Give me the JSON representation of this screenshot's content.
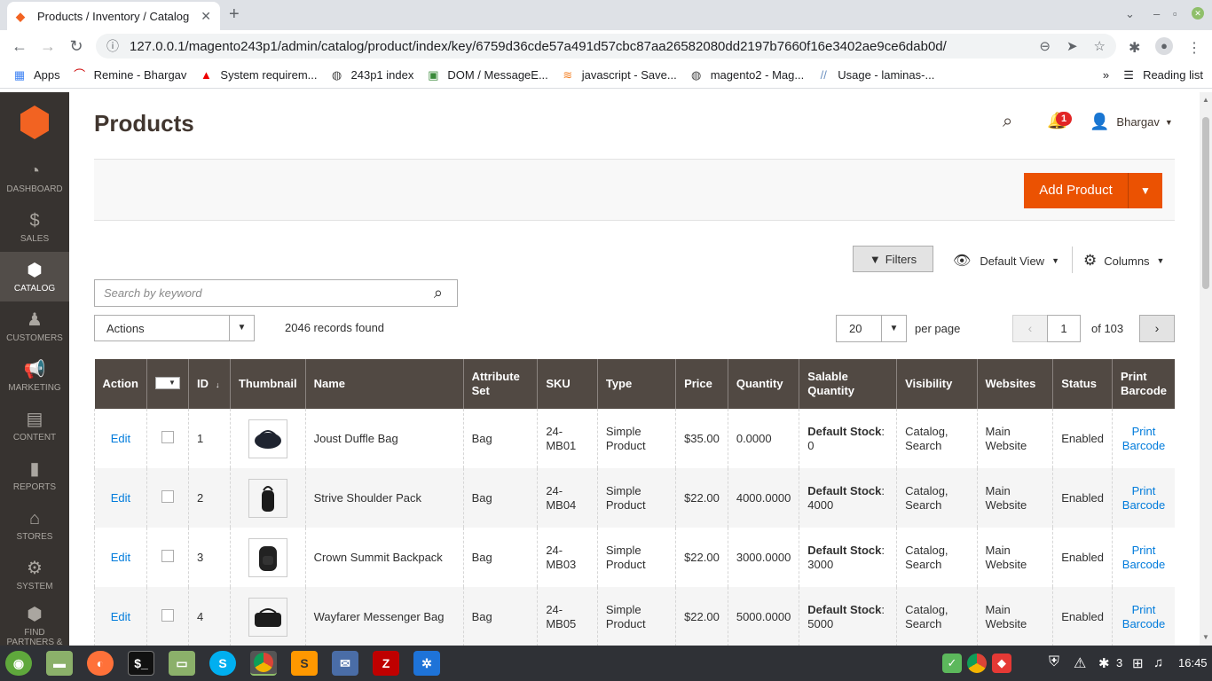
{
  "browser": {
    "tab_title": "Products / Inventory / Catalog",
    "url": "127.0.0.1/magento243p1/admin/catalog/product/index/key/6759d36cde57a491d57cbc87aa26582080dd2197b7660f16e3402ae9ce6dab0d/",
    "bookmarks": [
      {
        "label": "Apps",
        "icon": "apps-icon"
      },
      {
        "label": "Remine - Bhargav",
        "icon": "remine-icon"
      },
      {
        "label": "System requirem...",
        "icon": "adobe-icon"
      },
      {
        "label": "243p1 index",
        "icon": "globe-icon"
      },
      {
        "label": "DOM / MessageE...",
        "icon": "page-icon"
      },
      {
        "label": "javascript - Save...",
        "icon": "stackoverflow-icon"
      },
      {
        "label": "magento2 - Mag...",
        "icon": "globe-icon"
      },
      {
        "label": "Usage - laminas-...",
        "icon": "laminas-icon"
      }
    ],
    "reading_list": "Reading list"
  },
  "sidebar": {
    "items": [
      {
        "label": "DASHBOARD",
        "icon": "dashboard-icon",
        "glyph": "◔"
      },
      {
        "label": "SALES",
        "icon": "dollar-icon",
        "glyph": "$"
      },
      {
        "label": "CATALOG",
        "icon": "box-icon",
        "glyph": "⬢"
      },
      {
        "label": "CUSTOMERS",
        "icon": "person-icon",
        "glyph": "♟"
      },
      {
        "label": "MARKETING",
        "icon": "megaphone-icon",
        "glyph": "📢"
      },
      {
        "label": "CONTENT",
        "icon": "layout-icon",
        "glyph": "▤"
      },
      {
        "label": "REPORTS",
        "icon": "bar-chart-icon",
        "glyph": "▮"
      },
      {
        "label": "STORES",
        "icon": "store-icon",
        "glyph": "⌂"
      },
      {
        "label": "SYSTEM",
        "icon": "gear-icon",
        "glyph": "⚙"
      },
      {
        "label": "FIND PARTNERS & EXTENSIONS",
        "icon": "partners-icon",
        "glyph": "⬢"
      }
    ]
  },
  "header": {
    "title": "Products",
    "notifications": "1",
    "user": "Bhargav"
  },
  "toolbar": {
    "add_product": "Add Product",
    "filters": "Filters",
    "default_view": "Default View",
    "columns": "Columns",
    "search_placeholder": "Search by keyword",
    "actions": "Actions",
    "records": "2046 records found",
    "per_page_value": "20",
    "per_page_label": "per page",
    "page": "1",
    "of_pages": "of 103"
  },
  "table": {
    "headers": [
      "Action",
      "",
      "ID",
      "Thumbnail",
      "Name",
      "Attribute Set",
      "SKU",
      "Type",
      "Price",
      "Quantity",
      "Salable Quantity",
      "Visibility",
      "Websites",
      "Status",
      "Print Barcode"
    ],
    "rows": [
      {
        "action": "Edit",
        "id": "1",
        "name": "Joust Duffle Bag",
        "attr": "Bag",
        "sku": "24-MB01",
        "type": "Simple Product",
        "price": "$35.00",
        "qty": "0.0000",
        "salable_label": "Default Stock",
        "salable_value": ": 0",
        "visibility": "Catalog, Search",
        "websites": "Main Website",
        "status": "Enabled",
        "barcode": "Print Barcode"
      },
      {
        "action": "Edit",
        "id": "2",
        "name": "Strive Shoulder Pack",
        "attr": "Bag",
        "sku": "24-MB04",
        "type": "Simple Product",
        "price": "$22.00",
        "qty": "4000.0000",
        "salable_label": "Default Stock",
        "salable_value": ": 4000",
        "visibility": "Catalog, Search",
        "websites": "Main Website",
        "status": "Enabled",
        "barcode": "Print Barcode"
      },
      {
        "action": "Edit",
        "id": "3",
        "name": "Crown Summit Backpack",
        "attr": "Bag",
        "sku": "24-MB03",
        "type": "Simple Product",
        "price": "$22.00",
        "qty": "3000.0000",
        "salable_label": "Default Stock",
        "salable_value": ": 3000",
        "visibility": "Catalog, Search",
        "websites": "Main Website",
        "status": "Enabled",
        "barcode": "Print Barcode"
      },
      {
        "action": "Edit",
        "id": "4",
        "name": "Wayfarer Messenger Bag",
        "attr": "Bag",
        "sku": "24-MB05",
        "type": "Simple Product",
        "price": "$22.00",
        "qty": "5000.0000",
        "salable_label": "Default Stock",
        "salable_value": ": 5000",
        "visibility": "Catalog, Search",
        "websites": "Main Website",
        "status": "Enabled",
        "barcode": "Print Barcode"
      }
    ]
  },
  "taskbar": {
    "clock": "16:45",
    "workspace": "3"
  },
  "colors": {
    "accent": "#eb5202",
    "sidebar": "#373330",
    "table_header": "#514943",
    "link": "#007bdb"
  }
}
